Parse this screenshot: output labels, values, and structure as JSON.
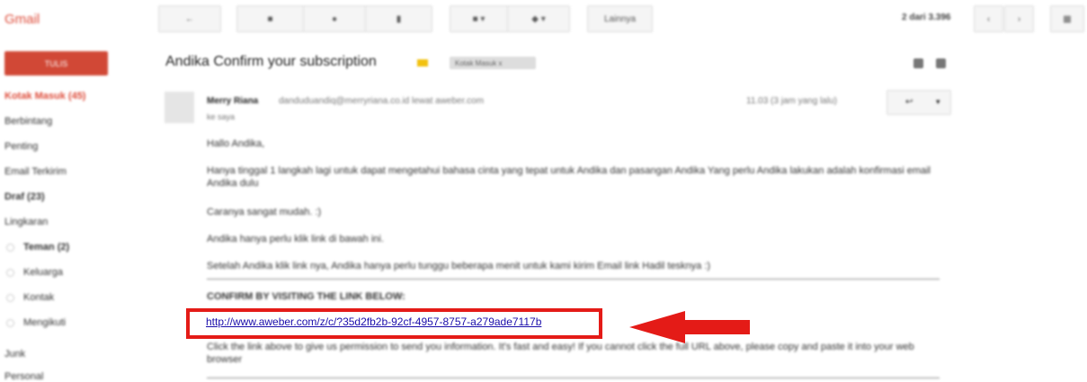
{
  "app": {
    "logo": "Gmail"
  },
  "toolbar": {
    "back_icon": "back-arrow-icon",
    "archive_icon": "archive-icon",
    "spam_icon": "spam-icon",
    "delete_icon": "trash-icon",
    "move_icon": "folder-icon",
    "label_icon": "tag-icon",
    "more_label": "Lainnya",
    "pager_text": "2 dari 3.396",
    "settings_icon": "grid-icon"
  },
  "sidebar": {
    "compose_label": "TULIS",
    "items": [
      {
        "label": "Kotak Masuk (45)"
      },
      {
        "label": "Berbintang"
      },
      {
        "label": "Penting"
      },
      {
        "label": "Email Terkirim"
      },
      {
        "label": "Draf (23)"
      },
      {
        "label": "Lingkaran"
      },
      {
        "label": "Teman (2)"
      },
      {
        "label": "Keluarga"
      },
      {
        "label": "Kontak"
      },
      {
        "label": "Mengikuti"
      },
      {
        "label": "Junk"
      },
      {
        "label": "Personal"
      }
    ]
  },
  "thread": {
    "subject": "Andika Confirm your subscription",
    "label_chip": "Kotak Masuk  x"
  },
  "message": {
    "sender_name": "Merry Riana",
    "sender_email": "danduduandiq@merryriana.co.id lewat aweber.com",
    "to_line": "ke saya",
    "time": "11.03 (3 jam yang lalu)",
    "greeting": "Hallo Andika,",
    "p1": "Hanya tinggal 1 langkah lagi untuk dapat mengetahui bahasa cinta yang tepat untuk Andika dan pasangan Andika Yang perlu Andika lakukan adalah konfirmasi email Andika dulu",
    "p2": "Caranya sangat mudah. :)",
    "p3": "Andika hanya perlu klik link di bawah ini.",
    "p4": "Setelah Andika klik link nya, Andika hanya perlu tunggu beberapa menit untuk kami kirim Email link Hadil tesknya :)",
    "confirm_heading": "CONFIRM BY VISITING THE LINK BELOW:",
    "confirm_link": "http://www.aweber.com/z/c/?35d2fb2b-92cf-4957-8757-a279ade7117b",
    "p5": "Click the link above to give us permission to send you information. It's fast and easy! If you cannot click the full URL above, please copy and paste it into your web browser"
  },
  "colors": {
    "highlight": "#e41b17",
    "link": "#1a0dab",
    "compose": "#d14836"
  }
}
